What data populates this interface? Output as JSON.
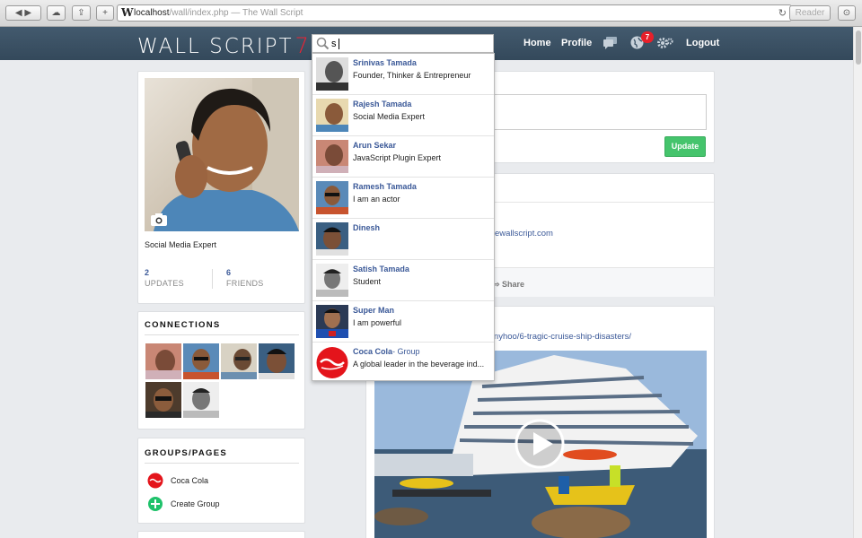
{
  "browser": {
    "address_host": "localhost",
    "address_path": "/wall/index.php",
    "title_sep": " — ",
    "page_title": "The Wall Script",
    "reader_label": "Reader"
  },
  "header": {
    "logo_text": "WALL SCRIPT",
    "logo_version": "7",
    "search_value": "s",
    "nav": {
      "home": "Home",
      "profile": "Profile",
      "logout": "Logout"
    },
    "notification_count": "7"
  },
  "profile": {
    "headline": "Social Media Expert",
    "updates_count": "2",
    "updates_label": "UPDATES",
    "friends_count": "6",
    "friends_label": "FRIENDS"
  },
  "connections": {
    "title": "CONNECTIONS"
  },
  "groups": {
    "title": "GROUPS/PAGES",
    "items": [
      {
        "label": "Coca Cola"
      },
      {
        "label": "Create Group"
      }
    ]
  },
  "composer": {
    "update_label": "Update"
  },
  "feed": {
    "post1_link_fragment": "ewallscript.com",
    "post1_share": "Share",
    "post2_link_fragment": "/anyhoo/6-tragic-cruise-ship-disasters/"
  },
  "search_results": [
    {
      "name": "Srinivas Tamada",
      "subtitle": "Founder, Thinker & Entrepreneur"
    },
    {
      "name": "Rajesh Tamada",
      "subtitle": "Social Media Expert"
    },
    {
      "name": "Arun Sekar",
      "subtitle": "JavaScript Plugin Expert"
    },
    {
      "name": "Ramesh Tamada",
      "subtitle": "I am an actor"
    },
    {
      "name": "Dinesh",
      "subtitle": ""
    },
    {
      "name": "Satish Tamada",
      "subtitle": "Student"
    },
    {
      "name": "Super Man",
      "subtitle": "I am powerful"
    },
    {
      "name": "Coca Cola",
      "group_suffix": "- Group",
      "subtitle": "A global leader in the beverage ind..."
    }
  ],
  "colors": {
    "header": "#3b5266",
    "link": "#3b5998",
    "update_button": "#45c46c",
    "badge": "#e8202a"
  }
}
